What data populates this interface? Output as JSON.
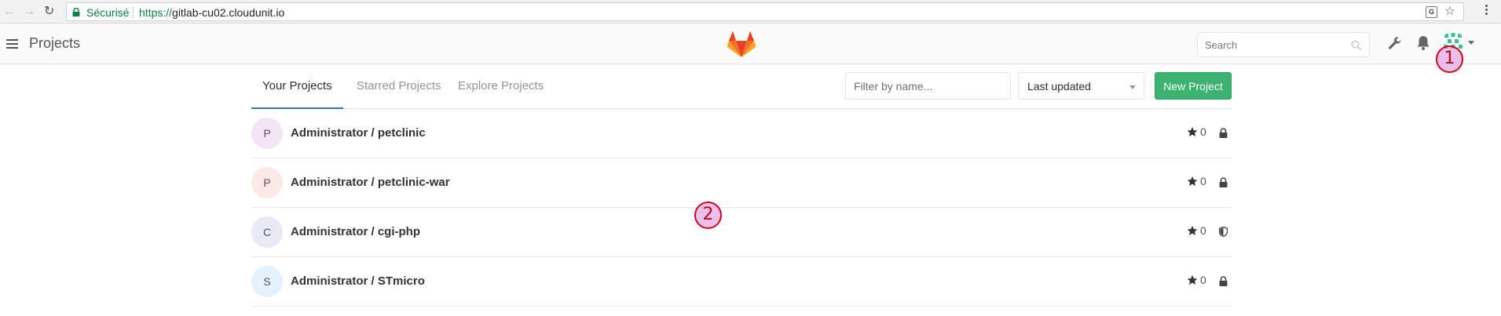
{
  "browser": {
    "secure_label": "Sécurisé",
    "url_scheme": "https://",
    "url_host": "gitlab-cu02.cloudunit.io"
  },
  "header": {
    "title": "Projects",
    "search_placeholder": "Search"
  },
  "annotations": [
    "1",
    "2"
  ],
  "tabs": [
    {
      "label": "Your Projects",
      "active": true
    },
    {
      "label": "Starred Projects",
      "active": false
    },
    {
      "label": "Explore Projects",
      "active": false
    }
  ],
  "filter": {
    "placeholder": "Filter by name..."
  },
  "sort": {
    "label": "Last updated"
  },
  "new_project_label": "New Project",
  "projects": [
    {
      "initial": "P",
      "name": "Administrator / petclinic",
      "stars": "0",
      "visibility": "private",
      "avatar_color": "#f3e5f5"
    },
    {
      "initial": "P",
      "name": "Administrator / petclinic-war",
      "stars": "0",
      "visibility": "private",
      "avatar_color": "#fbe9e7"
    },
    {
      "initial": "C",
      "name": "Administrator / cgi-php",
      "stars": "0",
      "visibility": "internal",
      "avatar_color": "#e8eaf6"
    },
    {
      "initial": "S",
      "name": "Administrator / STmicro",
      "stars": "0",
      "visibility": "private",
      "avatar_color": "#e3f2fd"
    }
  ],
  "colors": {
    "accent_green": "#3cb371",
    "active_tab_underline": "#3d6fb4",
    "secure_green": "#0b8043",
    "annotation_red": "#d0021b"
  }
}
